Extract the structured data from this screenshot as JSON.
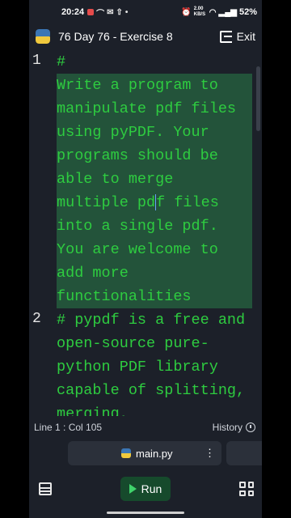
{
  "status_bar": {
    "time": "20:24",
    "speed": "2.00 KB/S",
    "battery": "52%"
  },
  "header": {
    "title": "76 Day 76 - Exercise 8",
    "exit_label": "Exit"
  },
  "editor": {
    "lines": [
      {
        "number": "1",
        "segments": [
          {
            "text": "#",
            "selected": false
          },
          {
            "text_before_caret": "Write a program to manipulate pdf files using pyPDF. Your programs should be able to merge multiple pd",
            "text_after_caret": "f files into a single pdf. You are welcome to add more functionalities",
            "selected": true
          }
        ]
      },
      {
        "number": "2",
        "segments": [
          {
            "text": "# pypdf is a free and open-source pure-python PDF library capable of splitting, merging,",
            "selected": false
          }
        ]
      }
    ]
  },
  "statusline": {
    "position": "Line 1 : Col 105",
    "history_label": "History"
  },
  "tabs": {
    "active_label": "main.py"
  },
  "bottom": {
    "run_label": "Run"
  },
  "colors": {
    "code_green": "#2ecc40",
    "selection": "#23533a",
    "background": "#1c2029",
    "run_bg": "#164a2c"
  },
  "icons": [
    "python-logo-icon",
    "exit-icon",
    "clock-icon",
    "kebab-icon",
    "files-icon",
    "play-icon",
    "grid-icon"
  ]
}
